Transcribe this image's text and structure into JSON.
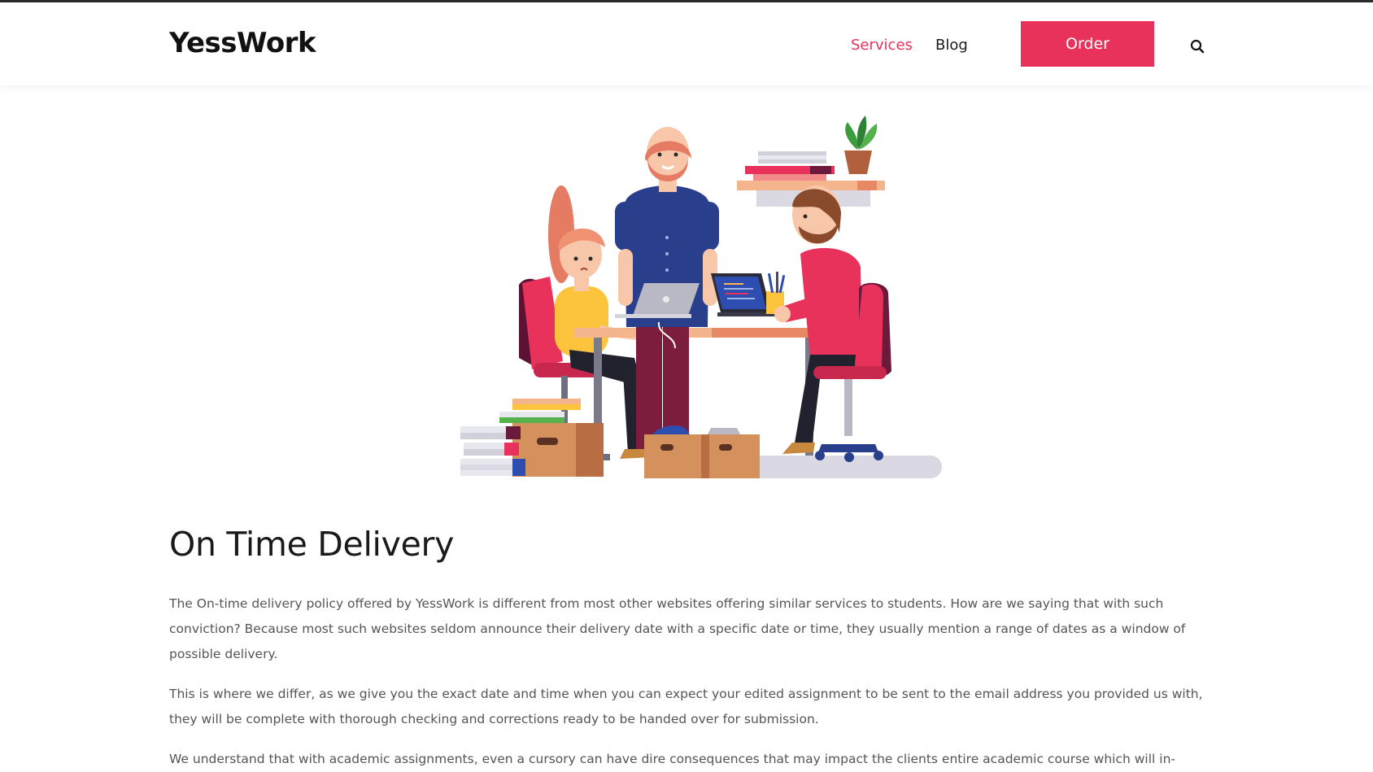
{
  "header": {
    "logo": "YessWork",
    "nav": {
      "services": "Services",
      "blog": "Blog"
    },
    "order_label": "Order",
    "search_icon": "search-icon"
  },
  "colors": {
    "accent": "#e8315b",
    "top_border": "#2b2b2b",
    "text": "#1a1a1a",
    "body_text": "#555555"
  },
  "main": {
    "illustration": "team-working-illustration",
    "heading": "On Time Delivery",
    "paragraphs": [
      "The On-time delivery policy offered by YessWork is different from most other websites offering similar services to students. How are we saying that with such conviction? Because most such websites seldom announce their delivery date with a specific date or time, they usually mention a range of dates as a window of possible delivery.",
      "This is where we differ, as we give you the exact date and time when you can expect your edited assignment to be sent to the email address you provided us with, they will be complete with thorough checking and corrections ready to be handed over for submission.",
      "We understand that with academic assignments, even a cursory can have dire consequences that may impact the clients entire academic course which will in-"
    ]
  }
}
